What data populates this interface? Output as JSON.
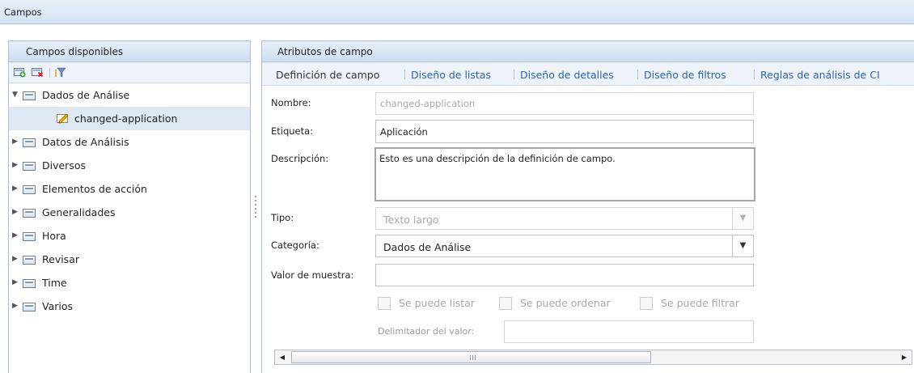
{
  "window": {
    "title": "Campos"
  },
  "left_panel": {
    "title": "Campos disponibles",
    "toolbar_icons": [
      "add-field-icon",
      "delete-field-icon",
      "filter-icon"
    ],
    "tree": [
      {
        "label": "Dados de Análise",
        "expanded": true
      },
      {
        "label": "changed-application",
        "child": true,
        "selected": true,
        "icon": "pencil-icon"
      },
      {
        "label": "Datos de Análisis",
        "expanded": false
      },
      {
        "label": "Diversos",
        "expanded": false
      },
      {
        "label": "Elementos de acción",
        "expanded": false
      },
      {
        "label": "Generalidades",
        "expanded": false
      },
      {
        "label": "Hora",
        "expanded": false
      },
      {
        "label": "Revisar",
        "expanded": false
      },
      {
        "label": "Time",
        "expanded": false
      },
      {
        "label": "Varios",
        "expanded": false
      }
    ]
  },
  "right_panel": {
    "title": "Atributos de campo",
    "tabs": [
      {
        "label": "Definición de campo",
        "active": true
      },
      {
        "label": "Diseño de listas"
      },
      {
        "label": "Diseño de detalles"
      },
      {
        "label": "Diseño de filtros"
      },
      {
        "label": "Reglas de análisis de CI"
      }
    ],
    "form": {
      "nombre_label": "Nombre:",
      "nombre_value": "changed-application",
      "etiqueta_label": "Etiqueta:",
      "etiqueta_value": "Aplicación",
      "descripcion_label": "Descripción:",
      "descripcion_value": "Esto es una descripción de la definición de campo.",
      "tipo_label": "Tipo:",
      "tipo_value": "Texto largo",
      "categoria_label": "Categoría:",
      "categoria_value": "Dados de Análise",
      "valor_label": "Valor de muestra:",
      "valor_value": "",
      "checkboxes": [
        "Se puede listar",
        "Se puede ordenar",
        "Se puede filtrar"
      ],
      "delimitador_label": "Delimitador del valor:",
      "delimitador_value": ""
    }
  },
  "colors": {
    "link": "#2a64b8",
    "header_bg": "#d3e2f3",
    "selected_row": "#dde8f4"
  }
}
